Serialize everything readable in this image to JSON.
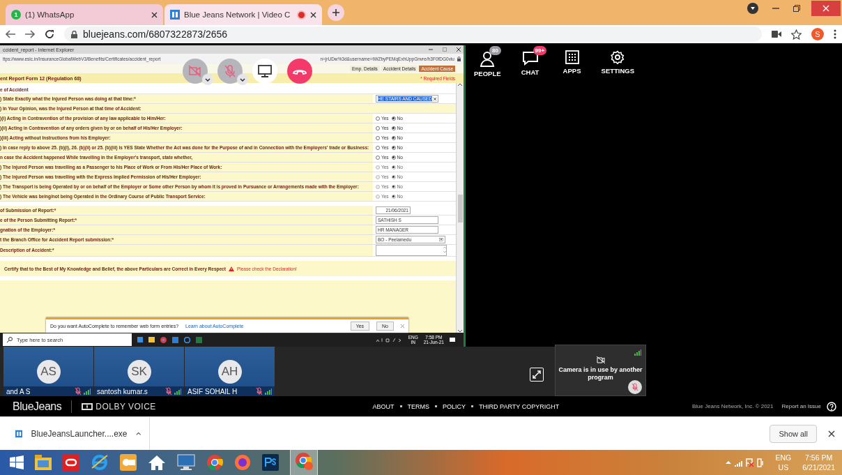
{
  "browser": {
    "tabs": [
      {
        "title": "(1) WhatsApp",
        "badge": "1",
        "selected": false,
        "recording": false
      },
      {
        "title": "Blue Jeans Network | Video C",
        "selected": true,
        "recording": true
      }
    ],
    "address": "bluejeans.com/6807322873/2656",
    "profile": "S"
  },
  "shared_screen": {
    "window_title": "ccident_report - Internet Explorer",
    "url_start": "ttps://www.esic.in/InsuranceGlobalWebV3/Benefits/Certificates/accident_report",
    "url_end": "n=jrUDw%3d&username=tWZbyPEMqExhUppGnvre/h3F0fDG0viu",
    "form_tabs": [
      {
        "label": "Emp. Details",
        "selected": false
      },
      {
        "label": "Accident Details",
        "selected": false
      },
      {
        "label": "Accident Cause",
        "selected": true
      }
    ],
    "form_title": "ent Report Form 12 (Regulation 68)",
    "required_note": "* Required Fields",
    "sections": [
      {
        "title": "e of Accident",
        "rows": [
          {
            "kind": "text",
            "label": ") State Exactly what the Injured Person was doing at that time:*",
            "value": "HE STAIRS AND CAUSED",
            "value_selected": true
          },
          {
            "kind": "heading",
            "label": ") In Your Opinion, was the Injured Person at that time of Accident:"
          },
          {
            "kind": "radio",
            "label": ")(i) Acting in Contravention of the provision of any law applicable to Him/Her:",
            "disabled": false,
            "options": [
              {
                "label": "Yes",
                "selected": false
              },
              {
                "label": "No",
                "selected": true
              }
            ]
          },
          {
            "kind": "radio",
            "label": ")(ii) Acting in Contravention of any orders given by or on behalf of His/Her Employer:",
            "disabled": false,
            "options": [
              {
                "label": "Yes",
                "selected": false
              },
              {
                "label": "No",
                "selected": true
              }
            ]
          },
          {
            "kind": "radio",
            "label": ")(iii) Acting without Instructions from his Employer:",
            "disabled": false,
            "options": [
              {
                "label": "Yes",
                "selected": false
              },
              {
                "label": "No",
                "selected": true
              }
            ]
          },
          {
            "kind": "radio",
            "label": ") In case reply to above 25. (b)(i), 26. (b)(ii) or 25. (b)(iii) is YES State Whether the Act was done for the Purpose of and in Connection with the Employers' trade or Business:",
            "disabled": false,
            "options": [
              {
                "label": "Yes",
                "selected": false
              },
              {
                "label": "No",
                "selected": true
              }
            ]
          },
          {
            "kind": "radio",
            "label": "n case the Accident happened While travelling in the Employer's transport, state whether,",
            "disabled": false,
            "options": [
              {
                "label": "Yes",
                "selected": false
              },
              {
                "label": "No",
                "selected": true
              }
            ]
          },
          {
            "kind": "radio",
            "label": ") The Injured Person was travelling as a Passenger to his Place of Work or From His/Her Place of Work:",
            "disabled": true,
            "options": [
              {
                "label": "Yes",
                "selected": false
              },
              {
                "label": "No",
                "selected": true
              }
            ]
          },
          {
            "kind": "radio",
            "label": ") The Injured Person was travelling with the Express Implied Permission of His/Her Employer:",
            "disabled": true,
            "options": [
              {
                "label": "Yes",
                "selected": false
              },
              {
                "label": "No",
                "selected": true
              }
            ]
          },
          {
            "kind": "radio",
            "label": ") The Transport is being Operated by or on behalf of the Employer or Some other Person by whom it is proved in Pursuance or Arrangements made with the Employer:",
            "disabled": true,
            "options": [
              {
                "label": "Yes",
                "selected": false
              },
              {
                "label": "No",
                "selected": true
              }
            ]
          },
          {
            "kind": "radio",
            "label": ") The Vehicle was being/not being Operated in the Ordinary Course of Public Transport Service:",
            "disabled": true,
            "options": [
              {
                "label": "Yes",
                "selected": false
              },
              {
                "label": "No",
                "selected": true
              }
            ]
          }
        ]
      },
      {
        "rows": [
          {
            "kind": "date",
            "label": "of Submission of Report:*",
            "value": "21/06/2021"
          },
          {
            "kind": "text",
            "label": "e of the Person Submitting Report:*",
            "value": "SATHISH S",
            "value_selected": false
          },
          {
            "kind": "text",
            "label": "gnation of the Employer:*",
            "value": "HR MANAGER",
            "value_selected": false
          },
          {
            "kind": "select",
            "label": "t the Branch Office for Accident Report submission:*",
            "value": "BO - Peelamedu"
          },
          {
            "kind": "textarea",
            "label": "Description of Accident:*"
          }
        ]
      },
      {
        "rows": [
          {
            "kind": "declaration",
            "label": "Certify that to the Best of My Knowledge and Belief, the above Particulars are Correct in Every Respect",
            "warning": "Please check the Declaration!"
          }
        ]
      }
    ],
    "autocomplete": {
      "question": "Do you want AutoComplete to remember web form entries?",
      "link": "Learn about AutoComplete",
      "buttons": [
        "Yes",
        "No"
      ]
    },
    "taskbar": {
      "search_placeholder": "Type here to search",
      "language": "ENG",
      "region": "IN",
      "time": "7:58 PM",
      "date": "21-Jun-21"
    }
  },
  "call_controls": {
    "camera_muted": true,
    "mic_muted": true
  },
  "nav": [
    {
      "kind": "people",
      "label": "PEOPLE",
      "badge": "80"
    },
    {
      "kind": "chat",
      "label": "CHAT",
      "badge": "99+"
    },
    {
      "kind": "apps",
      "label": "APPS"
    },
    {
      "kind": "settings",
      "label": "SETTINGS"
    }
  ],
  "participants": [
    {
      "initials": "AS",
      "name": "and A S",
      "muted": true
    },
    {
      "initials": "SK",
      "name": "santosh kumar.s",
      "muted": true
    },
    {
      "initials": "AH",
      "name": "ASIF SOHAIL H",
      "muted": true
    }
  ],
  "self_view": {
    "message": "Camera is in use by another program",
    "muted": true
  },
  "footer": {
    "brand": "BlueJeans",
    "partner": "DOLBY VOICE",
    "links": [
      "ABOUT",
      "TERMS",
      "POLICY",
      "THIRD PARTY COPYRIGHT"
    ],
    "copyright": "Blue Jeans Network, Inc. © 2021",
    "report": "Report an Issue"
  },
  "downloads": {
    "file": "BlueJeansLauncher....exe",
    "show_all": "Show all"
  },
  "taskbar": {
    "language": "ENG",
    "region": "US",
    "time": "7:56 PM",
    "date": "6/21/2021"
  }
}
